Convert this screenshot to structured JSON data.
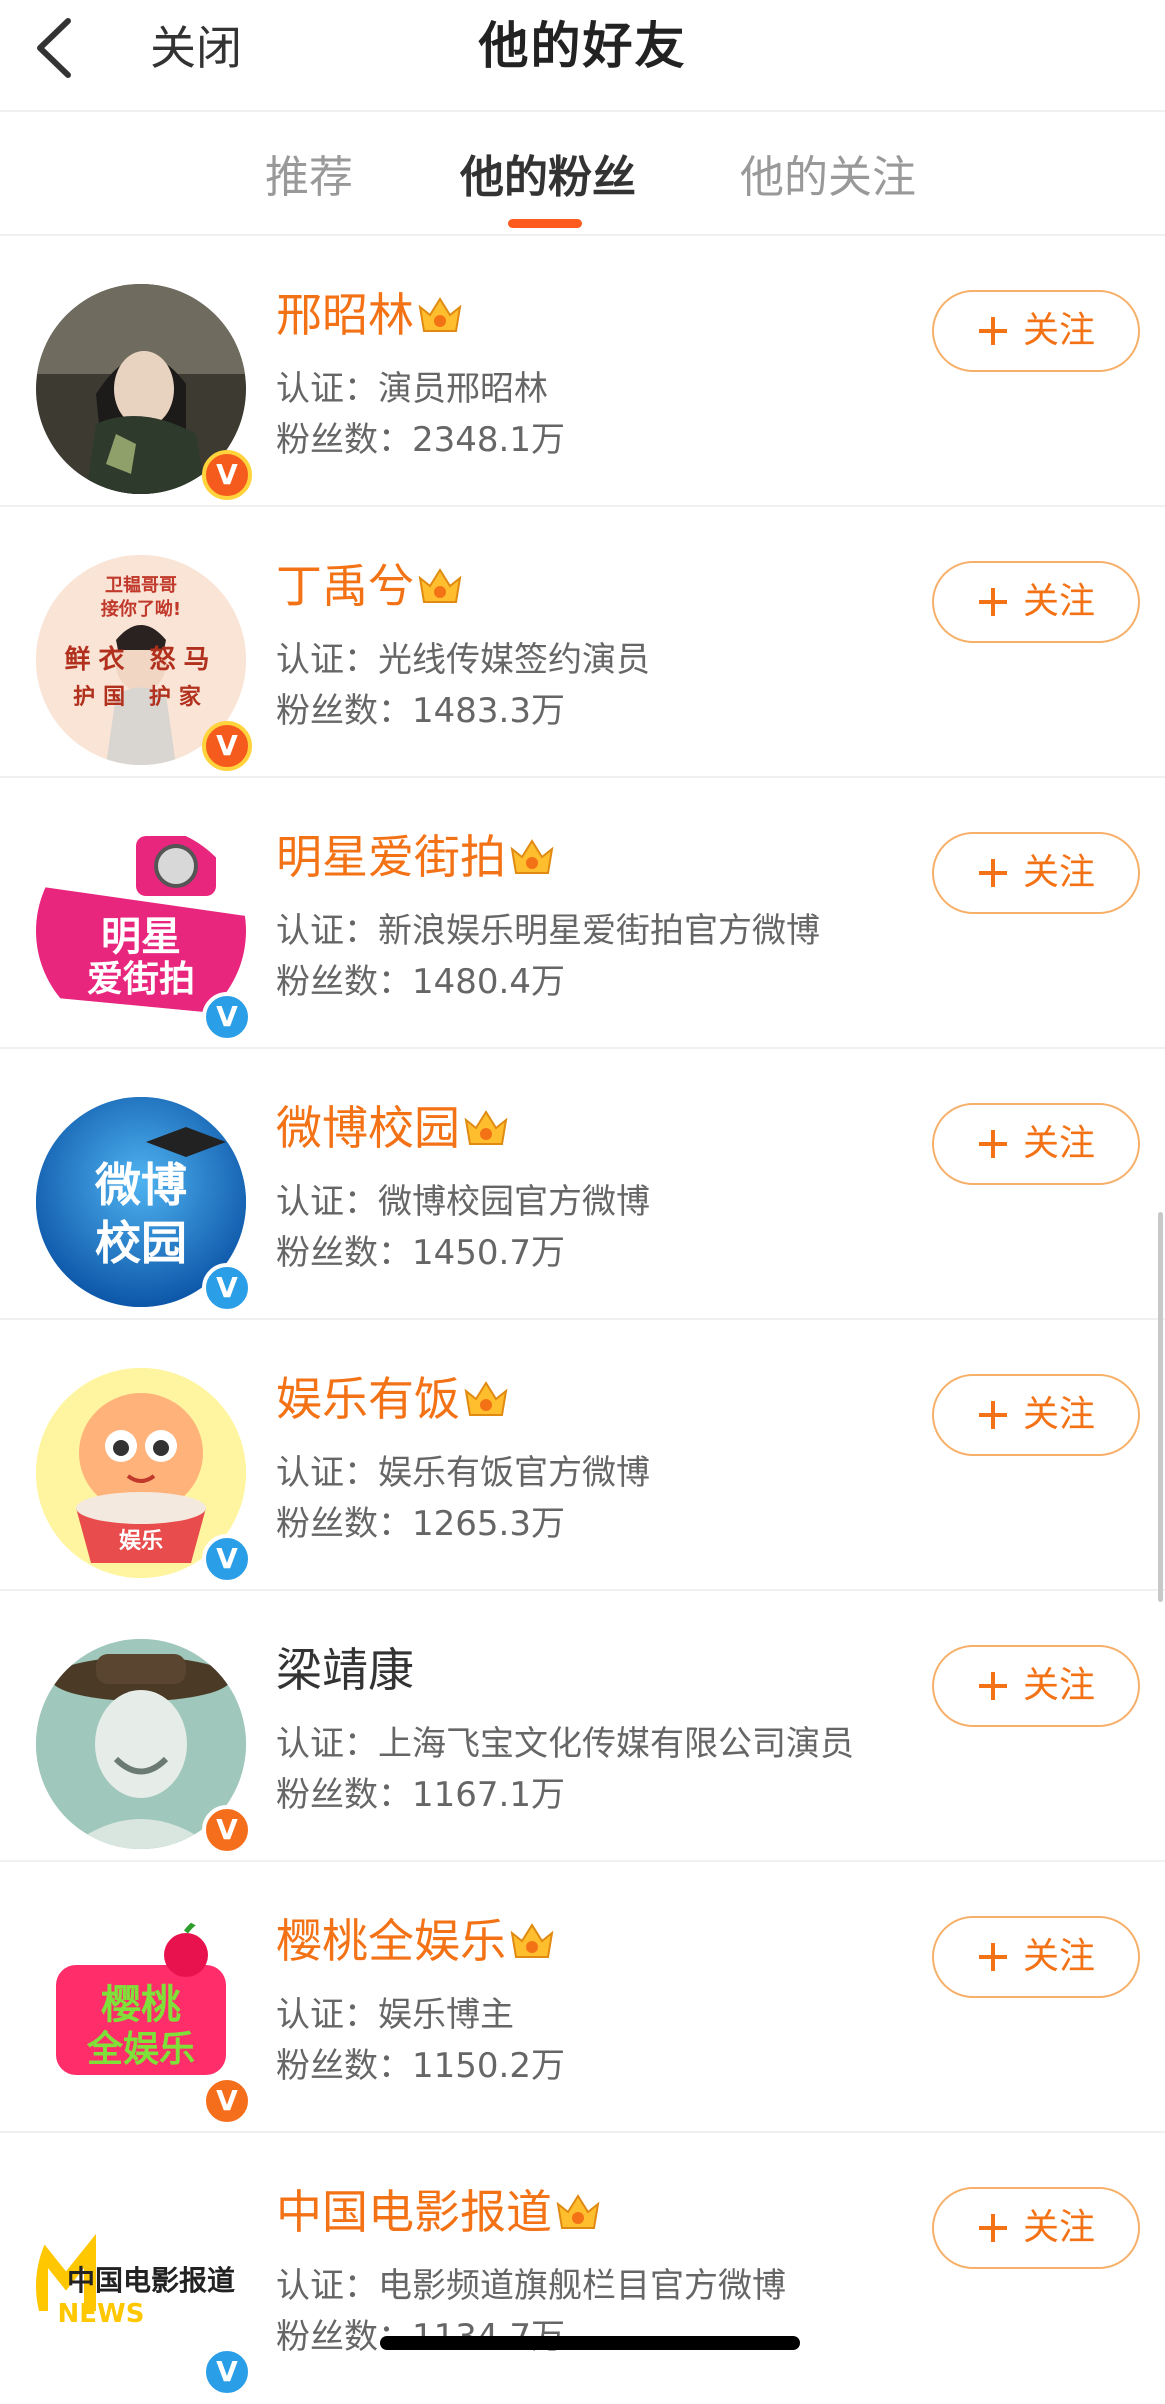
{
  "header": {
    "close_label": "关闭",
    "title": "他的好友",
    "back_icon": "chevron-left-icon"
  },
  "tabs": [
    {
      "label": "推荐",
      "active": false
    },
    {
      "label": "他的粉丝",
      "active": true
    },
    {
      "label": "他的关注",
      "active": false
    }
  ],
  "follow_label": "关注",
  "colors": {
    "accent": "#f47216",
    "tab_indicator": "#ff5a1e",
    "verified_blue": "#2a9ee6",
    "verified_orange": "#f56e1c"
  },
  "users": [
    {
      "name": "邢昭林",
      "vip": true,
      "badge": "orange",
      "cert": "认证：演员邢昭林",
      "fans": "粉丝数：2348.1万"
    },
    {
      "name": "丁禹兮",
      "vip": true,
      "badge": "orange",
      "cert": "认证：光线传媒签约演员",
      "fans": "粉丝数：1483.3万",
      "avatar_text": [
        "卫韫哥哥",
        "接你了呦!",
        "鲜衣 怒马",
        "护国 护家"
      ]
    },
    {
      "name": "明星爱街拍",
      "vip": true,
      "badge": "blue",
      "cert": "认证：新浪娱乐明星爱街拍官方微博",
      "fans": "粉丝数：1480.4万",
      "avatar_text": [
        "明星",
        "爱街拍"
      ]
    },
    {
      "name": "微博校园",
      "vip": true,
      "badge": "blue",
      "cert": "认证：微博校园官方微博",
      "fans": "粉丝数：1450.7万",
      "avatar_text": [
        "微博",
        "校园"
      ]
    },
    {
      "name": "娱乐有饭",
      "vip": true,
      "badge": "blue",
      "cert": "认证：娱乐有饭官方微博",
      "fans": "粉丝数：1265.3万",
      "avatar_text": [
        "娱乐"
      ]
    },
    {
      "name": "梁靖康",
      "vip": false,
      "badge": "orange",
      "cert": "认证：上海飞宝文化传媒有限公司演员",
      "fans": "粉丝数：1167.1万"
    },
    {
      "name": "樱桃全娱乐",
      "vip": true,
      "badge": "orange",
      "cert": "认证：娱乐博主",
      "fans": "粉丝数：1150.2万",
      "avatar_text": [
        "樱桃",
        "全娱乐"
      ]
    },
    {
      "name": "中国电影报道",
      "vip": true,
      "badge": "blue",
      "cert": "认证：电影频道旗舰栏目官方微博",
      "fans": "粉丝数：1134.7万",
      "avatar_text": [
        "中国电影报道",
        "NEWS"
      ]
    }
  ]
}
